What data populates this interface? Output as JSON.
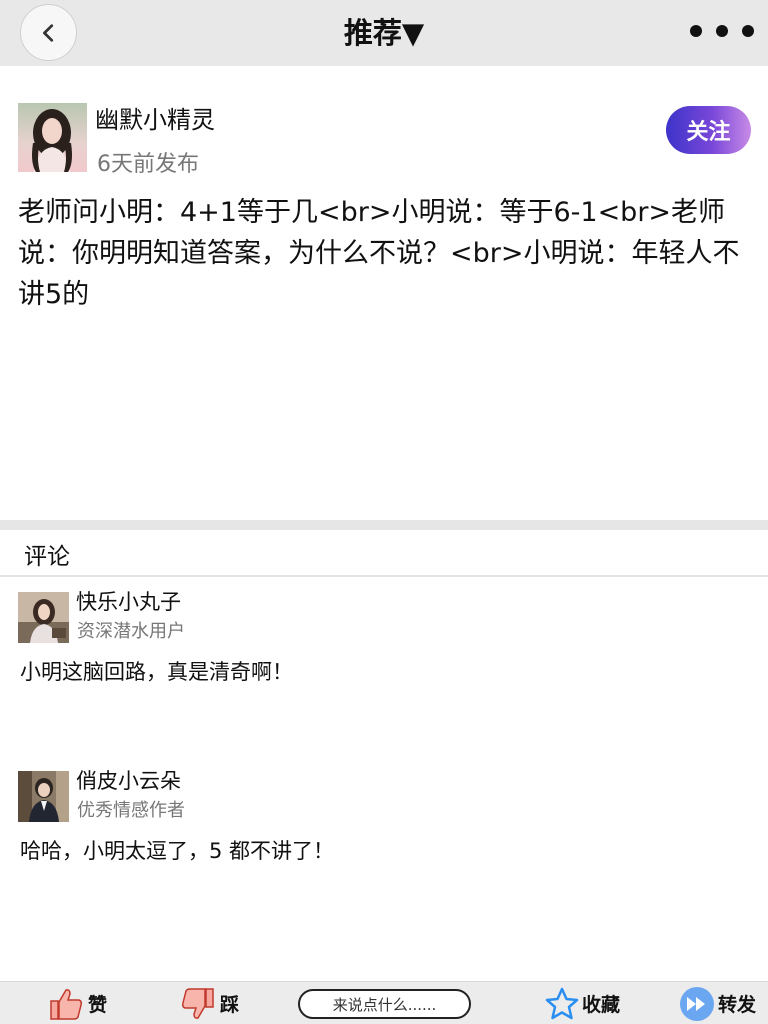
{
  "header": {
    "title": "推荐▼"
  },
  "post": {
    "author": "幽默小精灵",
    "time": "6天前发布",
    "follow_label": "关注",
    "content": "老师问小明：4+1等于几<br>小明说：等于6-1<br>老师说：你明明知道答案，为什么不说？<br>小明说：年轻人不讲5的"
  },
  "comments_section": {
    "title": "评论",
    "items": [
      {
        "name": "快乐小丸子",
        "badge": "资深潜水用户",
        "text": "小明这脑回路，真是清奇啊！"
      },
      {
        "name": "俏皮小云朵",
        "badge": "优秀情感作者",
        "text": "哈哈，小明太逗了，5 都不讲了！"
      }
    ]
  },
  "bottom_bar": {
    "like_label": "赞",
    "dislike_label": "踩",
    "input_placeholder": "来说点什么......",
    "favorite_label": "收藏",
    "share_label": "转发"
  },
  "colors": {
    "topbar_bg": "#e8e8e8",
    "follow_gradient_start": "#3d33c9",
    "follow_gradient_end": "#c88be6",
    "star_blue": "#2a8ff0",
    "share_blue": "#4a90e2"
  },
  "icons": [
    "chevron-left-icon",
    "more-dots-icon",
    "thumbs-up-icon",
    "thumbs-down-icon",
    "star-icon",
    "fast-forward-icon"
  ]
}
